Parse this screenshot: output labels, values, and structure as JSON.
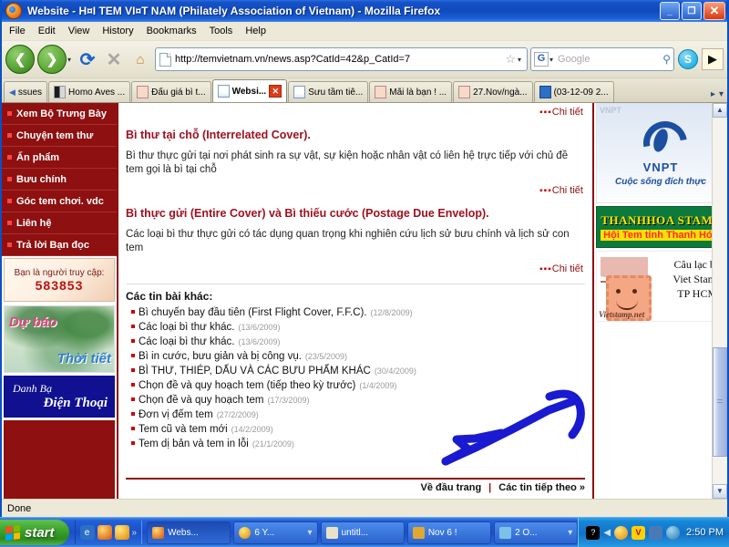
{
  "window": {
    "title": "Website - H¤I TEM VI¤T NAM (Philately Association of Vietnam) - Mozilla Firefox",
    "minimize_label": "_",
    "maximize_label": "❐",
    "close_label": "✕"
  },
  "menubar": [
    {
      "label": "File"
    },
    {
      "label": "Edit"
    },
    {
      "label": "View"
    },
    {
      "label": "History"
    },
    {
      "label": "Bookmarks"
    },
    {
      "label": "Tools"
    },
    {
      "label": "Help"
    }
  ],
  "toolbar": {
    "back": "❮",
    "forward": "❯",
    "dropdown": "▾",
    "reload": "⟳",
    "stop": "✕",
    "home": "⌂",
    "url": "http://temvietnam.vn/news.asp?CatId=42&p_CatId=7",
    "bookmark_star": "☆",
    "url_caret": "▾",
    "search_engine": "G",
    "search_placeholder": "Google",
    "search_value": "",
    "magnifier": "🔍",
    "skype_label": "S",
    "horn_label": "📣"
  },
  "tabs": {
    "prev_arrow": "◄",
    "items": [
      {
        "label": "ssues",
        "icon": "arrow",
        "active": false
      },
      {
        "label": "Homo Aves ...",
        "icon": "homo",
        "active": false
      },
      {
        "label": "Đấu giá bì t...",
        "icon": "stamp",
        "active": false
      },
      {
        "label": "Websi...",
        "icon": "doc",
        "active": true
      },
      {
        "label": "Sưu tầm tiê...",
        "icon": "doc",
        "active": false
      },
      {
        "label": "Mãi là bạn ! ...",
        "icon": "stamp",
        "active": false
      },
      {
        "label": "27.Nov/ngà...",
        "icon": "stamp",
        "active": false
      },
      {
        "label": "(03-12-09 2...",
        "icon": "blue",
        "active": false
      }
    ],
    "close_label": "✕",
    "next_arrow": "▸",
    "list_arrow": "▾"
  },
  "sidebar_left": {
    "nav": [
      {
        "label": "Xem Bộ Trưng Bày"
      },
      {
        "label": "Chuyện tem thư"
      },
      {
        "label": "Ấn phẩm"
      },
      {
        "label": "Bưu chính"
      },
      {
        "label": "Góc tem chơi. vdc"
      },
      {
        "label": "Liên hệ"
      },
      {
        "label": "Trả lời Bạn đọc"
      }
    ],
    "counter": {
      "label": "Bạn là người truy cập:",
      "value": "583853"
    },
    "ad_weather": {
      "line1": "Dự báo",
      "line2": "Thời tiết"
    },
    "ad_phone": {
      "line1": "Danh Bạ",
      "line2": "Điện Thoại"
    }
  },
  "content": {
    "detail_label": "Chi tiết",
    "dots": "▪▪▪",
    "articles": [
      {
        "title": "Bì thư tại chỗ (Interrelated Cover).",
        "body": "Bì thư thực gửi tại nơi phát sinh ra sự vật, sự kiện hoặc nhân vật có liên hệ trực tiếp với chủ đề tem gọi là bì tại chỗ"
      },
      {
        "title": "Bì thực gửi (Entire Cover) và Bì thiếu cước (Postage Due Envelop).",
        "body": "Các loại bì thư thực gửi có tác dụng quan trọng khi nghiên cứu lịch sử bưu chính và lịch sử con tem"
      }
    ],
    "others_title": "Các tin bài khác:",
    "news": [
      {
        "title": "Bì chuyến bay đầu tiên (First Flight Cover, F.F.C).",
        "date": "(12/8/2009)"
      },
      {
        "title": "Các loại bì thư khác.",
        "date": "(13/6/2009)"
      },
      {
        "title": "Các loại bì thư khác.",
        "date": "(13/6/2009)"
      },
      {
        "title": "Bì in cước, bưu giản và bị công vụ.",
        "date": "(23/5/2009)"
      },
      {
        "title": "BÌ THƯ, THIÉP, DẤU VÀ CÁC BƯU PHẨM KHÁC",
        "date": "(30/4/2009)"
      },
      {
        "title": "Chọn đề và quy hoạch tem (tiếp theo kỳ trước)",
        "date": "(1/4/2009)"
      },
      {
        "title": "Chọn đề và quy hoạch tem",
        "date": "(17/3/2009)"
      },
      {
        "title": "Đơn vị đếm tem",
        "date": "(27/2/2009)"
      },
      {
        "title": "Tem cũ và tem mới",
        "date": "(14/2/2009)"
      },
      {
        "title": "Tem dị bản và tem in lỗi",
        "date": "(21/1/2009)"
      }
    ],
    "footer": {
      "top_link": "Về đầu trang",
      "separator": "|",
      "next_link": "Các tin tiếp theo »"
    }
  },
  "sidebar_right": {
    "ad_vnpt": {
      "ghost": "VNPT",
      "title": "VNPT",
      "slogan": "Cuộc sống đích thực"
    },
    "ad_thanhhoa": {
      "line1": "THANHHOA STAMP",
      "line2": "Hội Tem tỉnh Thanh Hóa"
    },
    "ad_vietstamp": {
      "line1": "Câu lạc bộ",
      "line2": "Viet Stamp",
      "line3": "TP HCM",
      "watermark": "Vietstamp.net"
    }
  },
  "scrollbar": {
    "up": "▲",
    "down": "▼"
  },
  "statusbar": {
    "text": "Done"
  },
  "taskbar": {
    "start_label": "start",
    "quick_chevron": "»",
    "windows": [
      {
        "label": "Webs...",
        "icon_color": "#e07a20",
        "active": true
      },
      {
        "label": "6 Y...",
        "icon_color": "#e8b100",
        "active": false,
        "caret": "▾"
      },
      {
        "label": "untitl...",
        "icon_color": "#d8d0b0",
        "active": false
      },
      {
        "label": "Nov 6 !",
        "icon_color": "#e0a830",
        "active": false
      },
      {
        "label": "2 O...",
        "icon_color": "#6ab0e0",
        "active": false,
        "caret": "▾"
      }
    ],
    "tray_chevron": "◀",
    "clock": "2:50 PM"
  },
  "annotation": {
    "type": "hand-drawn-arrow",
    "color": "#1a1ad0",
    "points_to": "viet-stamp-ad"
  },
  "colors": {
    "brand_red": "#8e1010",
    "title_red": "#a01020",
    "accent_blue": "#1d4fa0",
    "annotation_blue": "#1a1ad0"
  }
}
